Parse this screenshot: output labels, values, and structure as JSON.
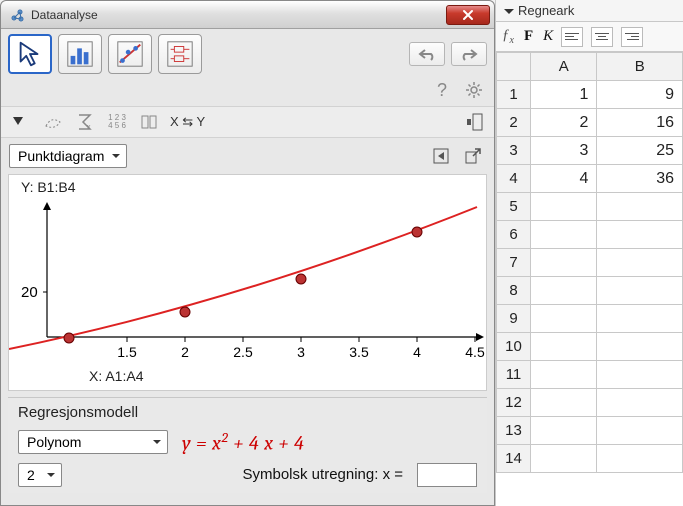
{
  "dialog": {
    "title": "Dataanalyse",
    "xy_label": "X ⇆ Y",
    "chartTypeDropdownValue": "Punktdiagram"
  },
  "plot": {
    "y_label": "Y:  B1:B4",
    "x_label": "X:  A1:A4",
    "y_tick": "20",
    "x_ticks": [
      "1.5",
      "2",
      "2.5",
      "3",
      "3.5",
      "4",
      "4.5"
    ]
  },
  "regression": {
    "title": "Regresjonsmodell",
    "model_value": "Polynom",
    "degree_value": "2",
    "formula_html": "y = x<sup>2</sup> + 4 x + 4",
    "symbolic_label": "Symbolsk utregning:  x =",
    "symbolic_value": ""
  },
  "sheet": {
    "title": "Regneark",
    "columns": [
      "A",
      "B"
    ],
    "rows": [
      {
        "n": "1",
        "A": "1",
        "B": "9",
        "sel": true
      },
      {
        "n": "2",
        "A": "2",
        "B": "16",
        "sel": true
      },
      {
        "n": "3",
        "A": "3",
        "B": "25",
        "sel": true
      },
      {
        "n": "4",
        "A": "4",
        "B": "36",
        "sel": true
      },
      {
        "n": "5",
        "A": "",
        "B": "",
        "sel": false
      },
      {
        "n": "6",
        "A": "",
        "B": "",
        "sel": false
      },
      {
        "n": "7",
        "A": "",
        "B": "",
        "sel": false
      },
      {
        "n": "8",
        "A": "",
        "B": "",
        "sel": false
      },
      {
        "n": "9",
        "A": "",
        "B": "",
        "sel": false
      },
      {
        "n": "10",
        "A": "",
        "B": "",
        "sel": false
      },
      {
        "n": "11",
        "A": "",
        "B": "",
        "sel": false
      },
      {
        "n": "12",
        "A": "",
        "B": "",
        "sel": false
      },
      {
        "n": "13",
        "A": "",
        "B": "",
        "sel": false
      },
      {
        "n": "14",
        "A": "",
        "B": "",
        "sel": false
      }
    ]
  },
  "chart_data": {
    "type": "scatter",
    "title": "",
    "xlabel": "X: A1:A4",
    "ylabel": "Y: B1:B4",
    "x": [
      1,
      2,
      3,
      4
    ],
    "y": [
      9,
      16,
      25,
      36
    ],
    "xlim": [
      0.8,
      4.5
    ],
    "ylim": [
      0,
      45
    ],
    "regression": {
      "model": "polynom",
      "degree": 2,
      "formula": "y = x^2 + 4x + 4"
    }
  }
}
